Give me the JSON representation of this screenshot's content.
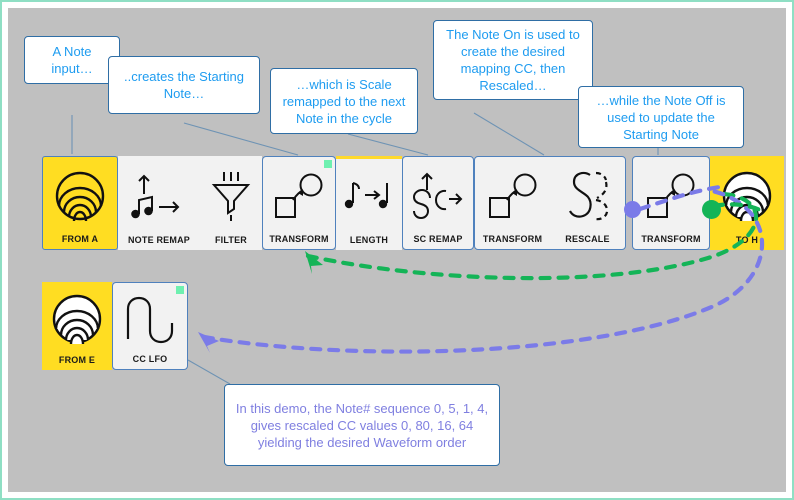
{
  "meta": {
    "canvas_bg": "#c0c0c0",
    "frame_border": "#8fdfc4",
    "callout_text_blue": "#1e9cf0",
    "callout_text_purple": "#7f7fe0",
    "callout_border": "#2f6ea5",
    "tile_border": "#4f81bd",
    "tile_bg": "#f2f2f2",
    "source_tile_bg": "#ffdd22",
    "badge_green": "#6ef0b0",
    "highlight_yellow": "#ffd92b",
    "arrow_green": "#14b457",
    "arrow_purple": "#7b7be8",
    "connector_line": "#6e93b4"
  },
  "callouts": [
    {
      "id": "note-input",
      "text": "A Note input…"
    },
    {
      "id": "starting-note",
      "text": "..creates the Starting Note…"
    },
    {
      "id": "scale-remap",
      "text": "…which is Scale remapped to the next Note in the cycle"
    },
    {
      "id": "note-on",
      "text": "The Note On is used to create the desired mapping CC,  then Rescaled…"
    },
    {
      "id": "note-off",
      "text": "…while the Note Off is used to update the Starting Note"
    },
    {
      "id": "demo-summary",
      "text": "In this demo, the Note# sequence 0, 5, 1, 4, gives rescaled CC values  0, 80, 16, 64 yielding  the desired Waveform order"
    }
  ],
  "main_chain": {
    "tiles": [
      {
        "label": "FROM A",
        "icon": "radiating-arcs-icon",
        "kind": "source",
        "badge": false,
        "highlight": false
      },
      {
        "label": "NOTE REMAP",
        "icon": "note-arrow-icon",
        "kind": "plain",
        "badge": false,
        "highlight": false
      },
      {
        "label": "FILTER",
        "icon": "funnel-icon",
        "kind": "plain",
        "badge": false,
        "highlight": false
      },
      {
        "label": "TRANSFORM",
        "icon": "square-to-circle-icon",
        "kind": "group",
        "badge": true,
        "highlight": false
      },
      {
        "label": "LENGTH",
        "icon": "note-to-note-icon",
        "kind": "plain",
        "badge": false,
        "highlight": true
      },
      {
        "label": "SC REMAP",
        "icon": "sc-arrow-icon",
        "kind": "group",
        "badge": false,
        "highlight": false
      },
      {
        "label": "TRANSFORM",
        "icon": "square-to-circle-icon",
        "kind": "group2a",
        "badge": false,
        "highlight": false
      },
      {
        "label": "RESCALE",
        "icon": "rescale-curve-icon",
        "kind": "group2b",
        "badge": false,
        "highlight": false
      },
      {
        "label": "TRANSFORM",
        "icon": "square-to-circle-icon",
        "kind": "group",
        "badge": false,
        "highlight": false
      },
      {
        "label": "TO H",
        "icon": "radiating-arcs-icon",
        "kind": "sink",
        "badge": false,
        "highlight": false
      }
    ]
  },
  "lfo_chain": {
    "tiles": [
      {
        "label": "FROM E",
        "icon": "radiating-arcs-icon",
        "kind": "source",
        "badge": false
      },
      {
        "label": "CC LFO",
        "icon": "lfo-wave-icon",
        "kind": "group",
        "badge": true
      }
    ]
  },
  "connection_dots": [
    {
      "id": "note-off-dot",
      "color": "#7b7be8"
    },
    {
      "id": "note-on-dot",
      "color": "#14b457"
    }
  ],
  "flow_arrows": [
    {
      "id": "green-feedback-arrow",
      "color": "#14b457",
      "style": "dashed",
      "target": "TRANSFORM"
    },
    {
      "id": "purple-feedback-arrow",
      "color": "#7b7be8",
      "style": "dashed",
      "target": "CC LFO"
    }
  ]
}
